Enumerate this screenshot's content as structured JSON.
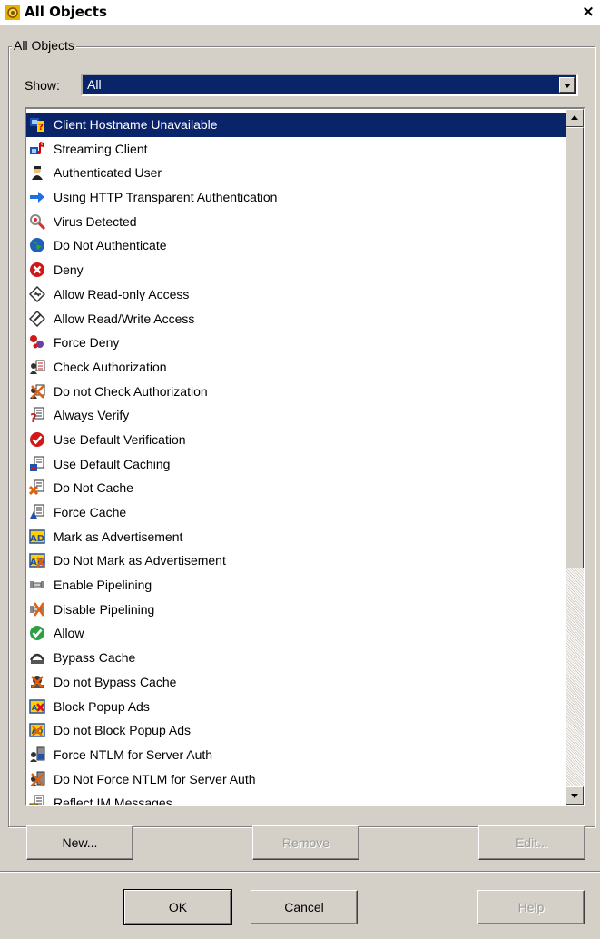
{
  "window": {
    "title": "All Objects",
    "close_label": "×"
  },
  "group": {
    "label": "All Objects"
  },
  "show": {
    "label": "Show:",
    "value": "All"
  },
  "list": {
    "items": [
      {
        "label": "Client Hostname Unavailable",
        "icon": "client-hostname-unavailable-icon",
        "selected": true
      },
      {
        "label": "Streaming Client",
        "icon": "streaming-client-icon"
      },
      {
        "label": "Authenticated User",
        "icon": "authenticated-user-icon"
      },
      {
        "label": "Using HTTP Transparent Authentication",
        "icon": "blue-arrow-icon"
      },
      {
        "label": "Virus Detected",
        "icon": "virus-magnifier-icon"
      },
      {
        "label": "Do Not Authenticate",
        "icon": "globe-icon"
      },
      {
        "label": "Deny",
        "icon": "deny-x-icon"
      },
      {
        "label": "Allow Read-only Access",
        "icon": "read-only-icon"
      },
      {
        "label": "Allow Read/Write Access",
        "icon": "read-write-icon"
      },
      {
        "label": "Force Deny",
        "icon": "force-deny-icon"
      },
      {
        "label": "Check Authorization",
        "icon": "check-authorization-icon"
      },
      {
        "label": "Do not Check Authorization",
        "icon": "no-check-authorization-icon"
      },
      {
        "label": "Always Verify",
        "icon": "always-verify-icon"
      },
      {
        "label": "Use Default Verification",
        "icon": "red-check-icon"
      },
      {
        "label": "Use Default Caching",
        "icon": "default-caching-icon"
      },
      {
        "label": "Do Not Cache",
        "icon": "no-cache-icon"
      },
      {
        "label": "Force Cache",
        "icon": "force-cache-icon"
      },
      {
        "label": "Mark as Advertisement",
        "icon": "ad-icon"
      },
      {
        "label": "Do Not Mark as Advertisement",
        "icon": "no-ad-icon"
      },
      {
        "label": "Enable Pipelining",
        "icon": "pipeline-icon"
      },
      {
        "label": "Disable Pipelining",
        "icon": "no-pipeline-icon"
      },
      {
        "label": "Allow",
        "icon": "green-check-icon"
      },
      {
        "label": "Bypass Cache",
        "icon": "bypass-cache-icon"
      },
      {
        "label": "Do not Bypass Cache",
        "icon": "no-bypass-cache-icon"
      },
      {
        "label": "Block Popup Ads",
        "icon": "block-popup-icon"
      },
      {
        "label": "Do not Block Popup Ads",
        "icon": "no-block-popup-icon"
      },
      {
        "label": "Force NTLM for Server Auth",
        "icon": "ntlm-icon"
      },
      {
        "label": "Do Not Force NTLM for Server Auth",
        "icon": "no-ntlm-icon"
      },
      {
        "label": "Reflect IM Messages",
        "icon": "im-messages-icon"
      }
    ]
  },
  "buttons": {
    "new": "New...",
    "remove": "Remove",
    "edit": "Edit...",
    "ok": "OK",
    "cancel": "Cancel",
    "help": "Help"
  },
  "colors": {
    "selection": "#0a246a",
    "face": "#d4d0c8",
    "disabled_text": "#9c9a94"
  }
}
